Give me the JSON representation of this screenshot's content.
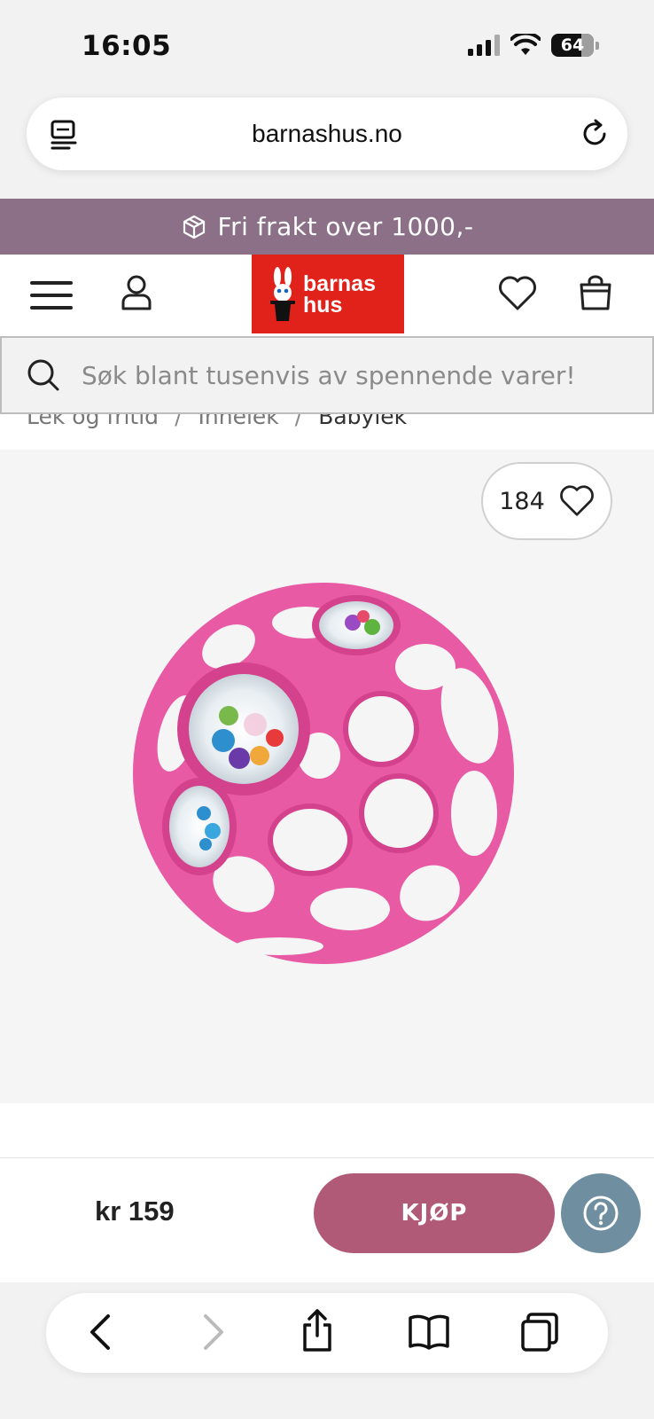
{
  "status_bar": {
    "time": "16:05",
    "battery": "64"
  },
  "browser": {
    "url": "barnashus.no",
    "icons": [
      "reader-mode-icon",
      "reload-icon",
      "back-icon",
      "forward-icon",
      "share-icon",
      "bookmarks-icon",
      "tabs-icon"
    ]
  },
  "promo": {
    "text": "Fri frakt over 1000,-",
    "icon": "package-icon"
  },
  "header": {
    "logo_line1": "barnas",
    "logo_line2": "hus",
    "icons": [
      "menu-icon",
      "user-icon",
      "heart-icon",
      "shopping-bag-icon"
    ]
  },
  "search": {
    "placeholder": "Søk blant tusenvis av spennende varer!"
  },
  "breadcrumb": {
    "items": [
      "Lek og fritid",
      "Innelek",
      "Babylek"
    ],
    "separator": "/"
  },
  "product": {
    "likes": "184"
  },
  "buy_bar": {
    "price": "kr 159",
    "buy_label": "KJØP"
  },
  "colors": {
    "promo_bg": "#8c7087",
    "logo_red": "#e1221a",
    "buy_button": "#b15a78",
    "help_button": "#6f8fa0",
    "product_pink": "#e85aa4"
  }
}
